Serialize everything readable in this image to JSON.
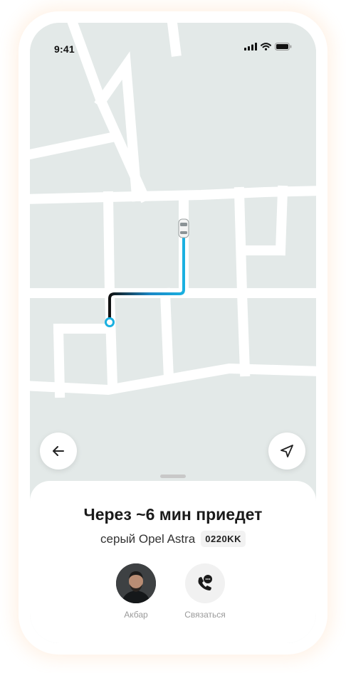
{
  "status_bar": {
    "time": "9:41"
  },
  "icons": {
    "back": "arrow-left-icon",
    "locate": "navigation-arrow-icon",
    "call": "phone-chat-icon",
    "car": "car-icon"
  },
  "colors": {
    "route_start": "#111111",
    "route_end": "#1ab0e0",
    "map_background": "#e3e9e8",
    "roads": "#ffffff",
    "sheet_background": "#ffffff"
  },
  "trip": {
    "eta_title": "Через ~6 мин приедет",
    "car_description": "серый Opel Astra",
    "plate_number": "0220KK"
  },
  "actions": {
    "driver_label": "Акбар",
    "contact_label": "Связаться"
  }
}
